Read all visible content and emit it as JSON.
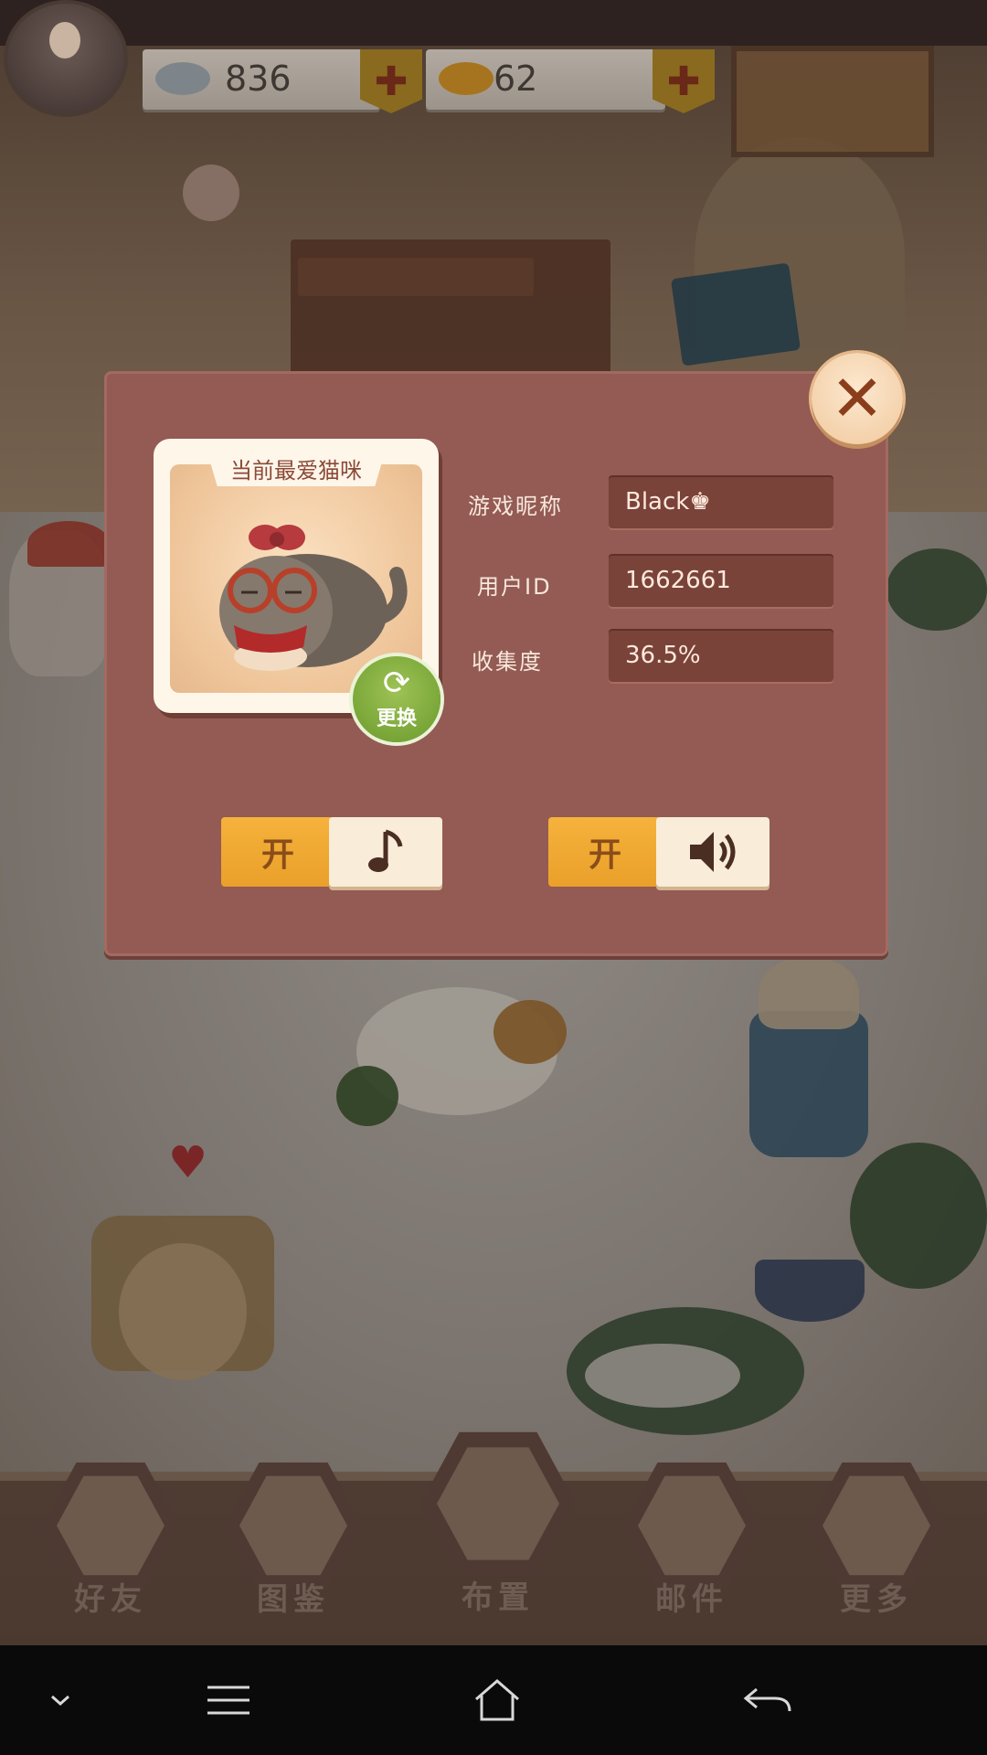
{
  "currency": {
    "fish_gray_value": "836",
    "fish_gold_value": "62",
    "plus_symbol": "✚"
  },
  "dialog": {
    "card_title": "当前最爱猫咪",
    "change_label": "更换",
    "close_symbol": "✕",
    "fields": [
      {
        "label": "游戏昵称",
        "value": "Black♚"
      },
      {
        "label": "用户ID",
        "value": "1662661"
      },
      {
        "label": "收集度",
        "value": "36.5%"
      }
    ],
    "music_toggle_label": "开",
    "sound_toggle_label": "开"
  },
  "menu": {
    "items": [
      {
        "label": "好友",
        "icon": "friends-icon"
      },
      {
        "label": "图鉴",
        "icon": "book-icon"
      },
      {
        "label": "布置",
        "icon": "vase-icon"
      },
      {
        "label": "邮件",
        "icon": "mail-icon"
      },
      {
        "label": "更多",
        "icon": "more-icon"
      }
    ]
  }
}
